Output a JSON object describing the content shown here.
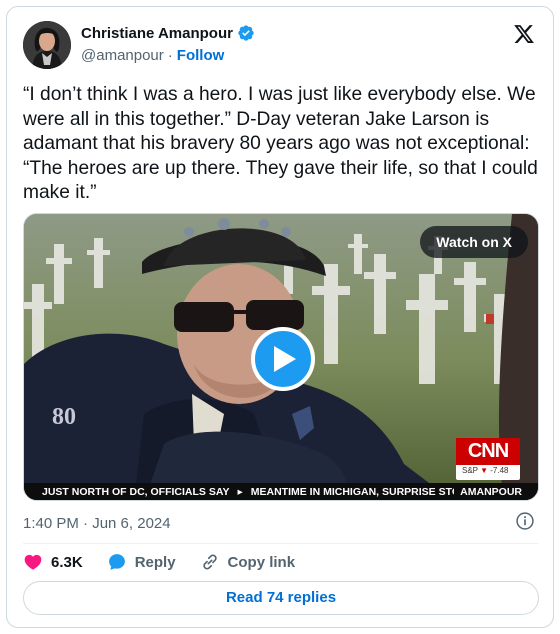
{
  "author": {
    "name": "Christiane Amanpour",
    "handle": "@amanpour",
    "follow_label": "Follow",
    "verified": true
  },
  "tweet": {
    "text": "“I don’t think I was a hero. I was just like everybody else. We were all in this together.” D-Day veteran Jake Larson is adamant that his bravery 80 years ago was not exceptional: “The heroes are up there. They gave their life, so that I could make it.”",
    "timestamp": "1:40 PM · Jun 6, 2024"
  },
  "media": {
    "watch_label": "Watch on X",
    "network_logo": "CNN",
    "ticker_symbol": "S&P",
    "ticker_value": "-7.48",
    "chyron_segments": [
      "JUST NORTH OF DC, OFFICIALS SAY",
      "MEANTIME IN MICHIGAN, SURPRISE STO"
    ],
    "chyron_separator": "▸",
    "chyron_tag": "AMANPOUR",
    "pin_text": "80"
  },
  "actions": {
    "likes": "6.3K",
    "reply_label": "Reply",
    "copy_label": "Copy link"
  },
  "read_replies_label": "Read 74 replies",
  "colors": {
    "link_blue": "#006fd6",
    "verified_blue": "#1d9bf0",
    "heart_pink": "#f91880",
    "text_primary": "#0f1419",
    "text_secondary": "#536471",
    "cnn_red": "#cc0000"
  },
  "icons": [
    "verified-badge-icon",
    "x-logo-icon",
    "play-icon",
    "info-icon",
    "heart-icon",
    "reply-bubble-icon",
    "link-icon"
  ]
}
